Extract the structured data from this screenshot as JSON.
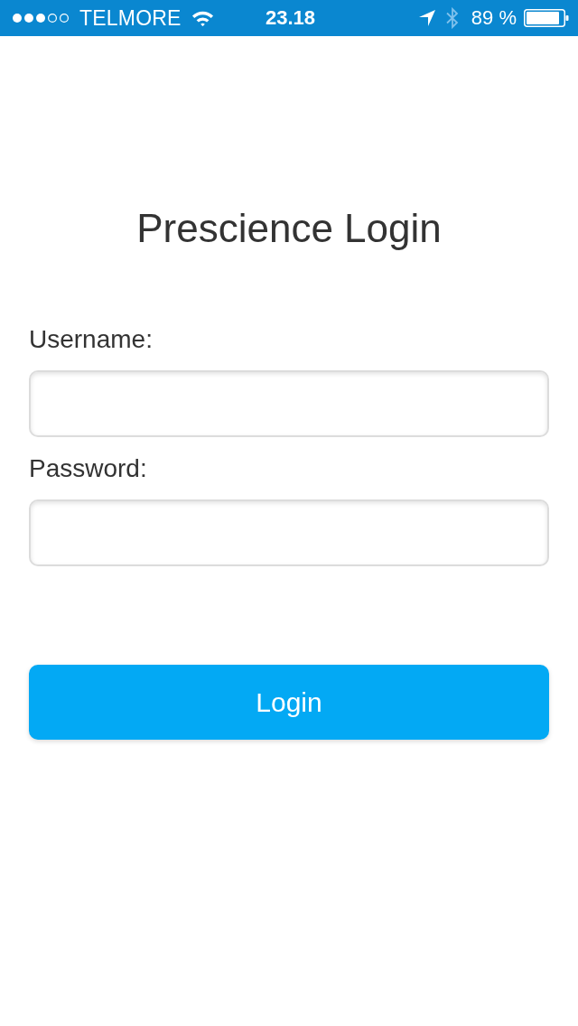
{
  "status_bar": {
    "carrier": "TELMORE",
    "time": "23.18",
    "battery": "89 %"
  },
  "title": "Prescience Login",
  "fields": [
    {
      "label": "Username:"
    },
    {
      "label": "Password:"
    }
  ],
  "button": {
    "label": "Login"
  }
}
